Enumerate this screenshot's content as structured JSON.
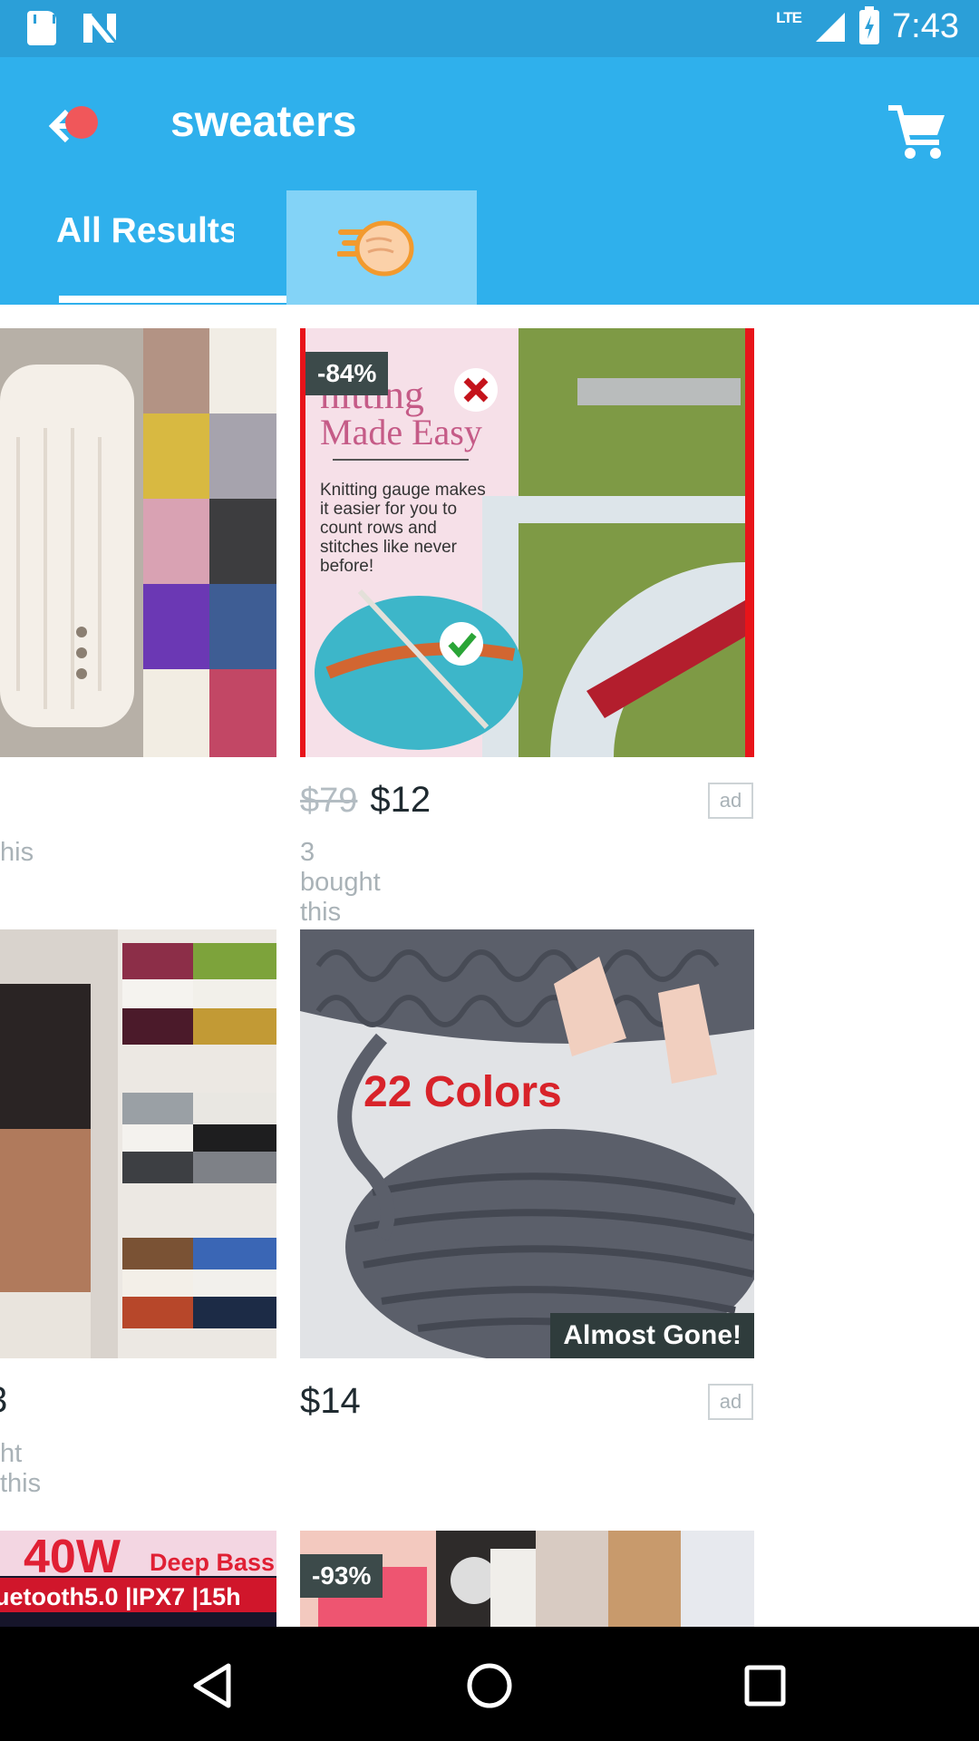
{
  "status_bar": {
    "network": "LTE",
    "time": "7:43"
  },
  "header": {
    "search_query": "sweaters",
    "colors": {
      "bar": "#2fb0ec",
      "status": "#2b9fd8",
      "notification": "#f0575a"
    }
  },
  "tabs": [
    {
      "label": "All Results",
      "selected": true
    },
    {
      "label": "",
      "icon": "fast-fist-icon",
      "selected": false
    }
  ],
  "products": [
    {
      "position": "left-column-row-1",
      "visible_text": "his"
    },
    {
      "position": "right-column-row-1",
      "discount": "-84%",
      "image_text": {
        "title_partial": "nitting",
        "title_line2": "Made Easy",
        "body": "Knitting gauge makes it easier for you to count rows and stitches like never before!"
      },
      "old_price": "$79",
      "price": "$12",
      "ad": "ad",
      "bought": "3 bought this"
    },
    {
      "position": "left-column-row-2",
      "visible_price": "3",
      "visible_text": "ht this"
    },
    {
      "position": "right-column-row-2",
      "image_text": "22 Colors",
      "badge": "Almost Gone!",
      "price": "$14",
      "ad": "ad"
    },
    {
      "position": "left-column-row-3",
      "image_text_big": "40W",
      "image_text_small": "Deep Bass",
      "image_text_line2": "uetooth5.0 |IPX7 |15h"
    },
    {
      "position": "right-column-row-3",
      "discount": "-93%"
    }
  ],
  "nav": {
    "back": "back-icon",
    "home": "home-icon",
    "recents": "recents-icon"
  }
}
